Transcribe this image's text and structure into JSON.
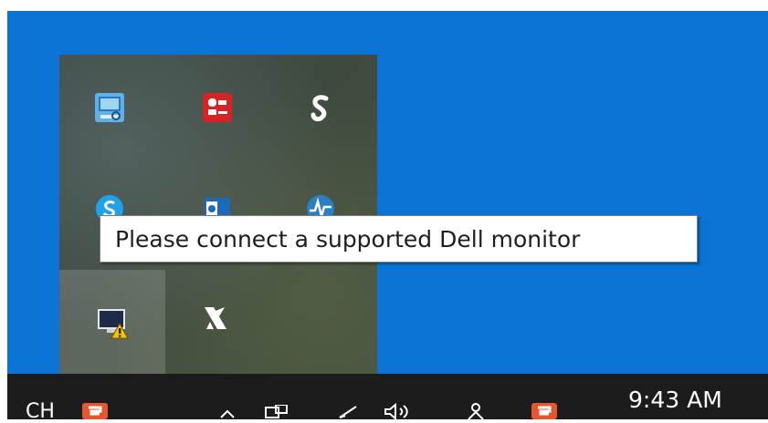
{
  "tooltip": {
    "text": "Please connect a supported Dell monitor"
  },
  "taskbar": {
    "language": "CH",
    "clock": "9:43 AM"
  },
  "tray_icons": [
    {
      "name": "network-monitor-icon"
    },
    {
      "name": "red-app-icon"
    },
    {
      "name": "s-logo-icon"
    },
    {
      "name": "skype-icon"
    },
    {
      "name": "outlook-icon"
    },
    {
      "name": "pulse-app-icon"
    },
    {
      "name": "dell-display-manager-warning-icon"
    },
    {
      "name": "x-logo-icon"
    }
  ],
  "colors": {
    "desktop": "#0a73d3",
    "taskbar": "#1c1c1c",
    "tooltip_bg": "#ffffff",
    "warning": "#f5c400"
  }
}
